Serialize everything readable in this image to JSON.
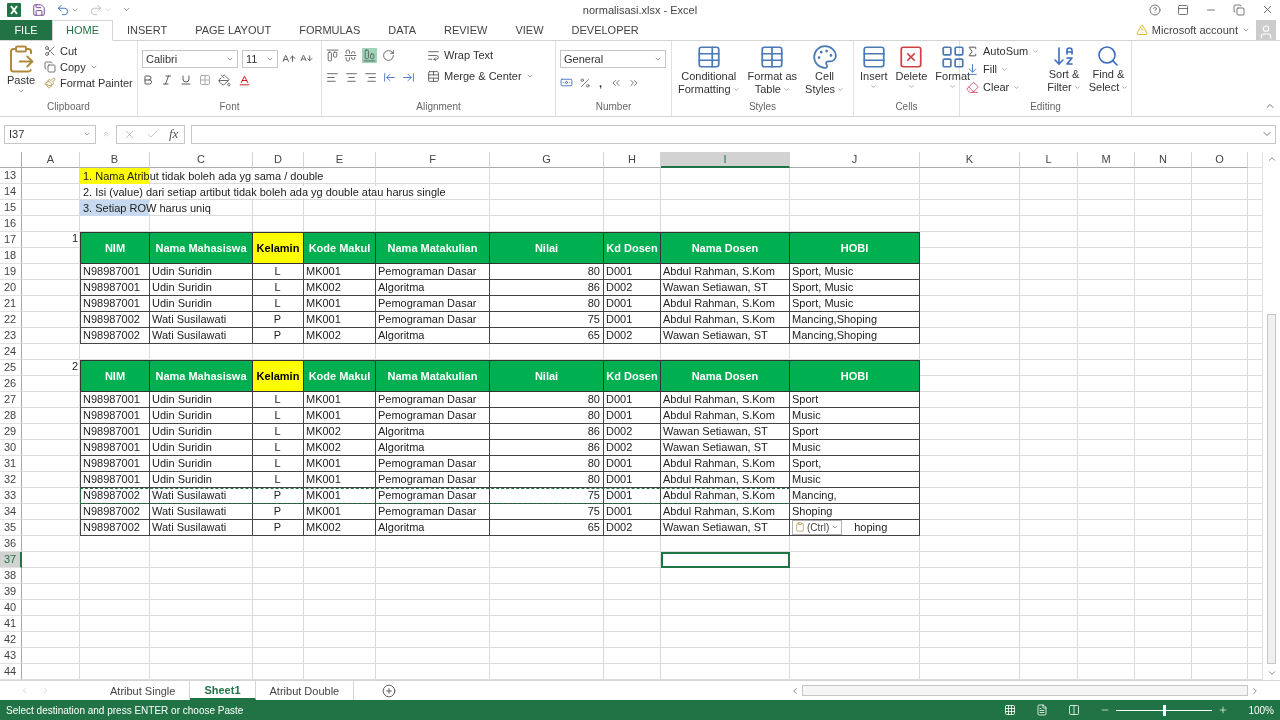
{
  "title_bar": {
    "title": "normalisasi.xlsx - Excel"
  },
  "ribbon_tabs": [
    {
      "label": "FILE",
      "kind": "file",
      "selected": false
    },
    {
      "label": "HOME",
      "kind": "tab",
      "selected": true
    },
    {
      "label": "INSERT",
      "kind": "tab",
      "selected": false
    },
    {
      "label": "PAGE LAYOUT",
      "kind": "tab",
      "selected": false
    },
    {
      "label": "FORMULAS",
      "kind": "tab",
      "selected": false
    },
    {
      "label": "DATA",
      "kind": "tab",
      "selected": false
    },
    {
      "label": "REVIEW",
      "kind": "tab",
      "selected": false
    },
    {
      "label": "VIEW",
      "kind": "tab",
      "selected": false
    },
    {
      "label": "DEVELOPER",
      "kind": "tab",
      "selected": false
    }
  ],
  "account": {
    "label": "Microsoft account"
  },
  "ribbon": {
    "clipboard": {
      "paste": "Paste",
      "cut": "Cut",
      "copy": "Copy",
      "format_painter": "Format Painter",
      "label": "Clipboard"
    },
    "font": {
      "name": "Calibri",
      "size": "11",
      "label": "Font"
    },
    "alignment": {
      "wrap_text": "Wrap Text",
      "merge_center": "Merge & Center",
      "label": "Alignment"
    },
    "number": {
      "format": "General",
      "comma": ",",
      "label": "Number"
    },
    "styles": {
      "buttons": [
        {
          "line1": "Conditional",
          "line2": "Formatting"
        },
        {
          "line1": "Format as",
          "line2": "Table"
        },
        {
          "line1": "Cell",
          "line2": "Styles"
        }
      ],
      "label": "Styles"
    },
    "cells": {
      "buttons": [
        "Insert",
        "Delete",
        "Format"
      ],
      "label": "Cells"
    },
    "editing": {
      "autosum": "AutoSum",
      "fill": "Fill",
      "clear": "Clear",
      "buttons": [
        {
          "line1": "Sort &",
          "line2": "Filter"
        },
        {
          "line1": "Find &",
          "line2": "Select"
        }
      ],
      "label": "Editing"
    }
  },
  "formula_bar": {
    "name_box": "I37",
    "function_label": "fx"
  },
  "sheet": {
    "columns": [
      {
        "label": "A",
        "selected": false
      },
      {
        "label": "B",
        "selected": false
      },
      {
        "label": "C",
        "selected": false
      },
      {
        "label": "D",
        "selected": false
      },
      {
        "label": "E",
        "selected": false
      },
      {
        "label": "F",
        "selected": false
      },
      {
        "label": "G",
        "selected": false
      },
      {
        "label": "H",
        "selected": false
      },
      {
        "label": "I",
        "selected": true
      },
      {
        "label": "J",
        "selected": false
      },
      {
        "label": "K",
        "selected": false
      },
      {
        "label": "L",
        "selected": false
      },
      {
        "label": "M",
        "selected": false
      },
      {
        "label": "N",
        "selected": false
      },
      {
        "label": "O",
        "selected": false
      }
    ],
    "rows": [
      {
        "label": "13",
        "selected": false
      },
      {
        "label": "14",
        "selected": false
      },
      {
        "label": "15",
        "selected": false
      },
      {
        "label": "16",
        "selected": false
      },
      {
        "label": "17",
        "selected": false
      },
      {
        "label": "18",
        "selected": false
      },
      {
        "label": "19",
        "selected": false
      },
      {
        "label": "20",
        "selected": false
      },
      {
        "label": "21",
        "selected": false
      },
      {
        "label": "22",
        "selected": false
      },
      {
        "label": "23",
        "selected": false
      },
      {
        "label": "24",
        "selected": false
      },
      {
        "label": "25",
        "selected": false
      },
      {
        "label": "26",
        "selected": false
      },
      {
        "label": "27",
        "selected": false
      },
      {
        "label": "28",
        "selected": false
      },
      {
        "label": "29",
        "selected": false
      },
      {
        "label": "30",
        "selected": false
      },
      {
        "label": "31",
        "selected": false
      },
      {
        "label": "32",
        "selected": false
      },
      {
        "label": "33",
        "selected": false
      },
      {
        "label": "34",
        "selected": false
      },
      {
        "label": "35",
        "selected": false
      },
      {
        "label": "36",
        "selected": false
      },
      {
        "label": "37",
        "selected": true
      },
      {
        "label": "38",
        "selected": false
      },
      {
        "label": "39",
        "selected": false
      },
      {
        "label": "40",
        "selected": false
      },
      {
        "label": "41",
        "selected": false
      },
      {
        "label": "42",
        "selected": false
      },
      {
        "label": "43",
        "selected": false
      },
      {
        "label": "44",
        "selected": false
      }
    ],
    "notes": [
      {
        "text": "1. Nama Atribut tidak boleh ada yg sama / double",
        "color": "#ffff00"
      },
      {
        "text": "2. Isi (value) dari setiap artibut tidak boleh ada yg double atau harus single"
      },
      {
        "text": "3. Setiap ROW harus uniq",
        "color": "#c6d9ee"
      }
    ],
    "tables": [
      {
        "label": "1",
        "headers": [
          {
            "text": "NIM",
            "highlighted": false
          },
          {
            "text": "Nama Mahasiswa",
            "highlighted": false
          },
          {
            "text": "Kelamin",
            "highlighted": true
          },
          {
            "text": "Kode Makul",
            "highlighted": false
          },
          {
            "text": "Nama Matakulian",
            "highlighted": false
          },
          {
            "text": "Nilai",
            "highlighted": false
          },
          {
            "text": "Kd Dosen",
            "highlighted": false
          },
          {
            "text": "Nama Dosen",
            "highlighted": false
          },
          {
            "text": "HOBI",
            "highlighted": false
          }
        ],
        "rows": [
          {
            "cells": [
              "N98987001",
              "Udin Suridin",
              "L",
              "MK001",
              "Pemograman Dasar",
              "80",
              "D001",
              "Abdul Rahman, S.Kom",
              "Sport, Music"
            ],
            "copied": false
          },
          {
            "cells": [
              "N98987001",
              "Udin Suridin",
              "L",
              "MK002",
              "Algoritma",
              "86",
              "D002",
              "Wawan Setiawan, ST",
              "Sport, Music"
            ],
            "copied": false
          },
          {
            "cells": [
              "N98987001",
              "Udin Suridin",
              "L",
              "MK001",
              "Pemograman Dasar",
              "80",
              "D001",
              "Abdul Rahman, S.Kom",
              "Sport, Music"
            ],
            "copied": false
          },
          {
            "cells": [
              "N98987002",
              "Wati Susilawati",
              "P",
              "MK001",
              "Pemograman Dasar",
              "75",
              "D001",
              "Abdul Rahman, S.Kom",
              "Mancing,Shoping"
            ],
            "copied": false
          },
          {
            "cells": [
              "N98987002",
              "Wati Susilawati",
              "P",
              "MK002",
              "Algoritma",
              "65",
              "D002",
              "Wawan Setiawan, ST",
              "Mancing,Shoping"
            ],
            "copied": false
          }
        ]
      },
      {
        "label": "2",
        "headers": [
          {
            "text": "NIM",
            "highlighted": false
          },
          {
            "text": "Nama Mahasiswa",
            "highlighted": false
          },
          {
            "text": "Kelamin",
            "highlighted": true
          },
          {
            "text": "Kode Makul",
            "highlighted": false
          },
          {
            "text": "Nama Matakulian",
            "highlighted": false
          },
          {
            "text": "Nilai",
            "highlighted": false
          },
          {
            "text": "Kd Dosen",
            "highlighted": false
          },
          {
            "text": "Nama Dosen",
            "highlighted": false
          },
          {
            "text": "HOBI",
            "highlighted": false
          }
        ],
        "rows": [
          {
            "cells": [
              "N98987001",
              "Udin Suridin",
              "L",
              "MK001",
              "Pemograman Dasar",
              "80",
              "D001",
              "Abdul Rahman, S.Kom",
              "Sport"
            ],
            "copied": false
          },
          {
            "cells": [
              "N98987001",
              "Udin Suridin",
              "L",
              "MK001",
              "Pemograman Dasar",
              "80",
              "D001",
              "Abdul Rahman, S.Kom",
              "Music"
            ],
            "copied": false
          },
          {
            "cells": [
              "N98987001",
              "Udin Suridin",
              "L",
              "MK002",
              "Algoritma",
              "86",
              "D002",
              "Wawan Setiawan, ST",
              "Sport"
            ],
            "copied": false
          },
          {
            "cells": [
              "N98987001",
              "Udin Suridin",
              "L",
              "MK002",
              "Algoritma",
              "86",
              "D002",
              "Wawan Setiawan, ST",
              "Music"
            ],
            "copied": false
          },
          {
            "cells": [
              "N98987001",
              "Udin Suridin",
              "L",
              "MK001",
              "Pemograman Dasar",
              "80",
              "D001",
              "Abdul Rahman, S.Kom",
              "Sport,"
            ],
            "copied": false
          },
          {
            "cells": [
              "N98987001",
              "Udin Suridin",
              "L",
              "MK001",
              "Pemograman Dasar",
              "80",
              "D001",
              "Abdul Rahman, S.Kom",
              "Music"
            ],
            "copied": false
          },
          {
            "cells": [
              "N98987002",
              "Wati Susilawati",
              "P",
              "MK001",
              "Pemograman Dasar",
              "75",
              "D001",
              "Abdul Rahman, S.Kom",
              "Mancing,"
            ],
            "copied": true
          },
          {
            "cells": [
              "N98987002",
              "Wati Susilawati",
              "P",
              "MK001",
              "Pemograman Dasar",
              "75",
              "D001",
              "Abdul Rahman, S.Kom",
              "Shoping"
            ],
            "copied": false
          },
          {
            "cells": [
              "N98987002",
              "Wati Susilawati",
              "P",
              "MK002",
              "Algoritma",
              "65",
              "D002",
              "Wawan Setiawan, ST",
              "hoping"
            ],
            "copied": false,
            "paste_options": "(Ctrl)"
          }
        ]
      }
    ]
  },
  "sheet_tabs": [
    {
      "label": "Atribut Single",
      "selected": false
    },
    {
      "label": "Sheet1",
      "selected": true
    },
    {
      "label": "Atribut Double",
      "selected": false
    }
  ],
  "status_bar": {
    "message": "Select destination and press ENTER or choose Paste",
    "zoom": "100%",
    "zoom_slider": {
      "level": 0.5
    }
  }
}
